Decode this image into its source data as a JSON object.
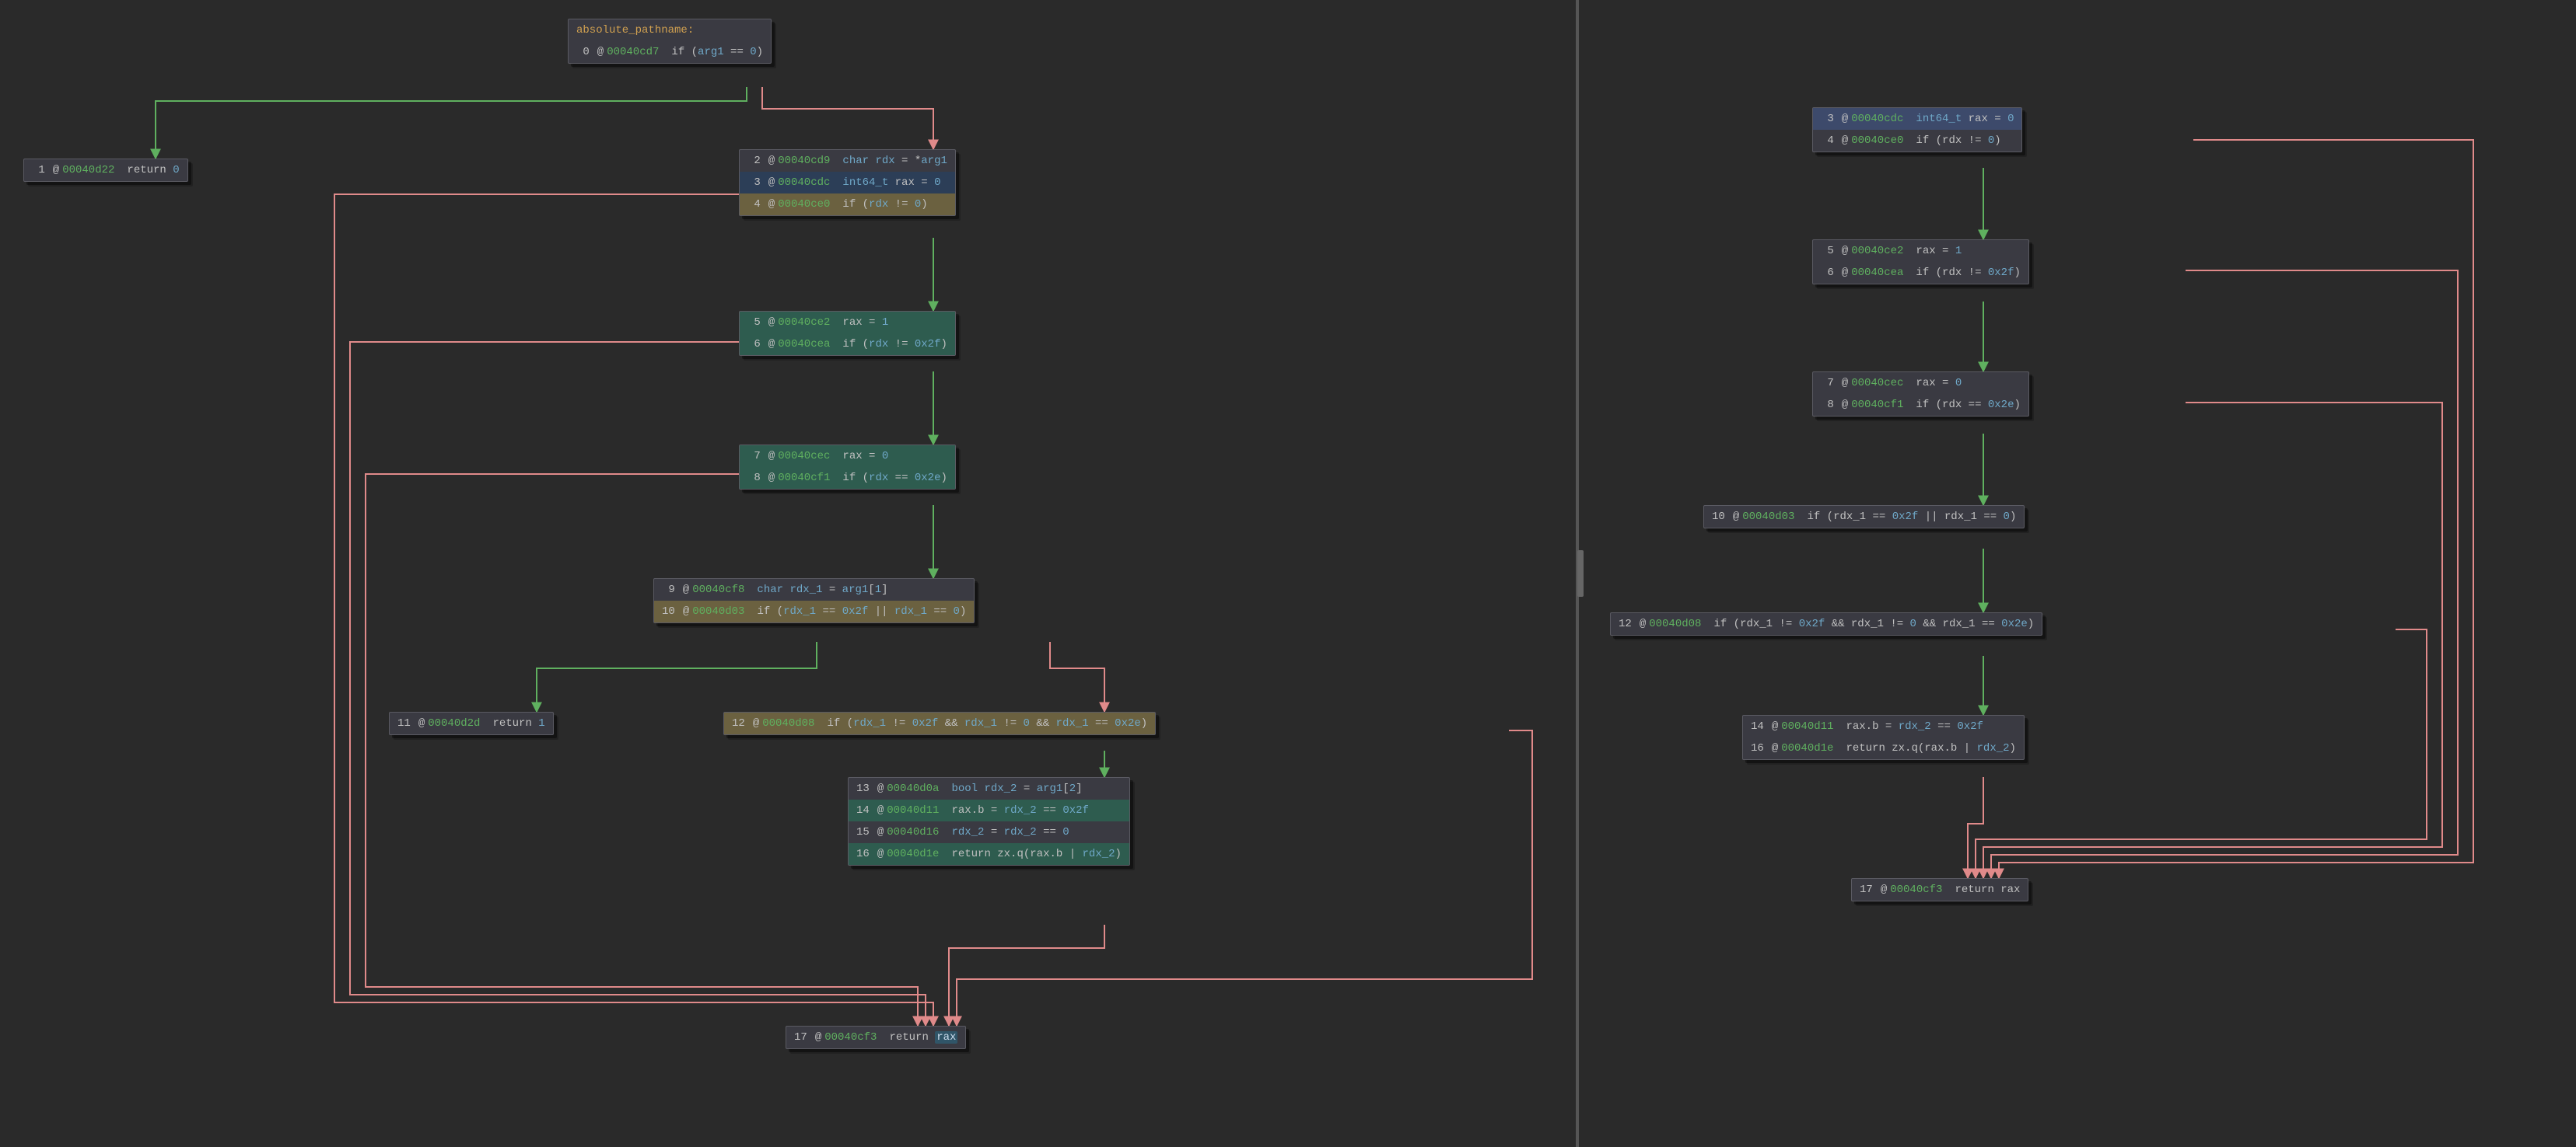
{
  "function_name": "absolute_pathname",
  "left": {
    "blocks": {
      "b0": {
        "title": "absolute_pathname:",
        "lines": [
          {
            "hl": "",
            "idx": "0",
            "addr": "00040cd7",
            "tokens": [
              [
                "kw",
                "if"
              ],
              [
                "op",
                " ("
              ],
              [
                "var",
                "arg1"
              ],
              [
                "op",
                " == "
              ],
              [
                "num",
                "0"
              ],
              [
                "op",
                ")"
              ]
            ]
          }
        ]
      },
      "b1": {
        "lines": [
          {
            "hl": "",
            "idx": "1",
            "addr": "00040d22",
            "tokens": [
              [
                "kw",
                "return "
              ],
              [
                "num",
                "0"
              ]
            ]
          }
        ]
      },
      "b2": {
        "lines": [
          {
            "hl": "",
            "idx": "2",
            "addr": "00040cd9",
            "tokens": [
              [
                "ty",
                "char "
              ],
              [
                "var",
                "rdx"
              ],
              [
                "op",
                " = *"
              ],
              [
                "var",
                "arg1"
              ]
            ]
          },
          {
            "hl": "hl-blue",
            "idx": "3",
            "addr": "00040cdc",
            "tokens": [
              [
                "ty",
                "int64_t "
              ],
              [
                "nm",
                "rax"
              ],
              [
                "op",
                " = "
              ],
              [
                "num",
                "0"
              ]
            ]
          },
          {
            "hl": "hl-olive",
            "idx": "4",
            "addr": "00040ce0",
            "tokens": [
              [
                "kw",
                "if"
              ],
              [
                "op",
                " ("
              ],
              [
                "var",
                "rdx"
              ],
              [
                "op",
                " != "
              ],
              [
                "num",
                "0"
              ],
              [
                "op",
                ")"
              ]
            ]
          }
        ]
      },
      "b5": {
        "lines": [
          {
            "hl": "hl-teal",
            "idx": "5",
            "addr": "00040ce2",
            "tokens": [
              [
                "nm",
                "rax"
              ],
              [
                "op",
                " = "
              ],
              [
                "num",
                "1"
              ]
            ]
          },
          {
            "hl": "hl-teal",
            "idx": "6",
            "addr": "00040cea",
            "tokens": [
              [
                "kw",
                "if"
              ],
              [
                "op",
                " ("
              ],
              [
                "var",
                "rdx"
              ],
              [
                "op",
                " != "
              ],
              [
                "num",
                "0x2f"
              ],
              [
                "op",
                ")"
              ]
            ]
          }
        ]
      },
      "b7": {
        "lines": [
          {
            "hl": "hl-teal",
            "idx": "7",
            "addr": "00040cec",
            "tokens": [
              [
                "nm",
                "rax"
              ],
              [
                "op",
                " = "
              ],
              [
                "num",
                "0"
              ]
            ]
          },
          {
            "hl": "hl-teal",
            "idx": "8",
            "addr": "00040cf1",
            "tokens": [
              [
                "kw",
                "if"
              ],
              [
                "op",
                " ("
              ],
              [
                "var",
                "rdx"
              ],
              [
                "op",
                " == "
              ],
              [
                "num",
                "0x2e"
              ],
              [
                "op",
                ")"
              ]
            ]
          }
        ]
      },
      "b9": {
        "lines": [
          {
            "hl": "",
            "idx": "9",
            "addr": "00040cf8",
            "tokens": [
              [
                "ty",
                "char "
              ],
              [
                "var",
                "rdx_1"
              ],
              [
                "op",
                " = "
              ],
              [
                "var",
                "arg1"
              ],
              [
                "op",
                "["
              ],
              [
                "num",
                "1"
              ],
              [
                "op",
                "]"
              ]
            ]
          },
          {
            "hl": "hl-olive",
            "idx": "10",
            "addr": "00040d03",
            "tokens": [
              [
                "kw",
                "if"
              ],
              [
                "op",
                " ("
              ],
              [
                "var",
                "rdx_1"
              ],
              [
                "op",
                " == "
              ],
              [
                "num",
                "0x2f"
              ],
              [
                "op",
                " || "
              ],
              [
                "var",
                "rdx_1"
              ],
              [
                "op",
                " == "
              ],
              [
                "num",
                "0"
              ],
              [
                "op",
                ")"
              ]
            ]
          }
        ]
      },
      "b11": {
        "lines": [
          {
            "hl": "",
            "idx": "11",
            "addr": "00040d2d",
            "tokens": [
              [
                "kw",
                "return "
              ],
              [
                "num",
                "1"
              ]
            ]
          }
        ]
      },
      "b12": {
        "lines": [
          {
            "hl": "hl-olive",
            "idx": "12",
            "addr": "00040d08",
            "tokens": [
              [
                "kw",
                "if"
              ],
              [
                "op",
                " ("
              ],
              [
                "var",
                "rdx_1"
              ],
              [
                "op",
                " != "
              ],
              [
                "num",
                "0x2f"
              ],
              [
                "op",
                " && "
              ],
              [
                "var",
                "rdx_1"
              ],
              [
                "op",
                " != "
              ],
              [
                "num",
                "0"
              ],
              [
                "op",
                " && "
              ],
              [
                "var",
                "rdx_1"
              ],
              [
                "op",
                " == "
              ],
              [
                "num",
                "0x2e"
              ],
              [
                "op",
                ")"
              ]
            ]
          }
        ]
      },
      "b13": {
        "lines": [
          {
            "hl": "",
            "idx": "13",
            "addr": "00040d0a",
            "tokens": [
              [
                "ty",
                "bool "
              ],
              [
                "var",
                "rdx_2"
              ],
              [
                "op",
                " = "
              ],
              [
                "var",
                "arg1"
              ],
              [
                "op",
                "["
              ],
              [
                "num",
                "2"
              ],
              [
                "op",
                "]"
              ]
            ]
          },
          {
            "hl": "hl-teal",
            "idx": "14",
            "addr": "00040d11",
            "tokens": [
              [
                "nm",
                "rax"
              ],
              [
                "op",
                "."
              ],
              [
                "nm",
                "b"
              ],
              [
                "op",
                " = "
              ],
              [
                "var",
                "rdx_2"
              ],
              [
                "op",
                " == "
              ],
              [
                "num",
                "0x2f"
              ]
            ]
          },
          {
            "hl": "",
            "idx": "15",
            "addr": "00040d16",
            "tokens": [
              [
                "var",
                "rdx_2"
              ],
              [
                "op",
                " = "
              ],
              [
                "var",
                "rdx_2"
              ],
              [
                "op",
                " == "
              ],
              [
                "num",
                "0"
              ]
            ]
          },
          {
            "hl": "hl-teal",
            "idx": "16",
            "addr": "00040d1e",
            "tokens": [
              [
                "kw",
                "return "
              ],
              [
                "nm",
                "zx.q"
              ],
              [
                "op",
                "("
              ],
              [
                "nm",
                "rax"
              ],
              [
                "op",
                "."
              ],
              [
                "nm",
                "b"
              ],
              [
                "op",
                " | "
              ],
              [
                "var",
                "rdx_2"
              ],
              [
                "op",
                ")"
              ]
            ]
          }
        ]
      },
      "b17": {
        "lines": [
          {
            "hl": "",
            "idx": "17",
            "addr": "00040cf3",
            "tokens": [
              [
                "kw",
                "return "
              ],
              [
                "hl-reg",
                "rax"
              ]
            ]
          }
        ]
      }
    }
  },
  "right": {
    "blocks": {
      "r3": {
        "lines": [
          {
            "hl": "hl-sel",
            "idx": "3",
            "addr": "00040cdc",
            "tokens": [
              [
                "ty",
                "int64_t "
              ],
              [
                "nm",
                "rax"
              ],
              [
                "op",
                " = "
              ],
              [
                "num",
                "0"
              ]
            ]
          },
          {
            "hl": "",
            "idx": "4",
            "addr": "00040ce0",
            "tokens": [
              [
                "kw",
                "if"
              ],
              [
                "op",
                " ("
              ],
              [
                "nm",
                "rdx"
              ],
              [
                "op",
                " != "
              ],
              [
                "num",
                "0"
              ],
              [
                "op",
                ")"
              ]
            ]
          }
        ]
      },
      "r5": {
        "lines": [
          {
            "hl": "",
            "idx": "5",
            "addr": "00040ce2",
            "tokens": [
              [
                "nm",
                "rax"
              ],
              [
                "op",
                " = "
              ],
              [
                "num",
                "1"
              ]
            ]
          },
          {
            "hl": "",
            "idx": "6",
            "addr": "00040cea",
            "tokens": [
              [
                "kw",
                "if"
              ],
              [
                "op",
                " ("
              ],
              [
                "nm",
                "rdx"
              ],
              [
                "op",
                " != "
              ],
              [
                "num",
                "0x2f"
              ],
              [
                "op",
                ")"
              ]
            ]
          }
        ]
      },
      "r7": {
        "lines": [
          {
            "hl": "",
            "idx": "7",
            "addr": "00040cec",
            "tokens": [
              [
                "nm",
                "rax"
              ],
              [
                "op",
                " = "
              ],
              [
                "num",
                "0"
              ]
            ]
          },
          {
            "hl": "",
            "idx": "8",
            "addr": "00040cf1",
            "tokens": [
              [
                "kw",
                "if"
              ],
              [
                "op",
                " ("
              ],
              [
                "nm",
                "rdx"
              ],
              [
                "op",
                " == "
              ],
              [
                "num",
                "0x2e"
              ],
              [
                "op",
                ")"
              ]
            ]
          }
        ]
      },
      "r10": {
        "lines": [
          {
            "hl": "",
            "idx": "10",
            "addr": "00040d03",
            "tokens": [
              [
                "kw",
                "if"
              ],
              [
                "op",
                " ("
              ],
              [
                "nm",
                "rdx_1"
              ],
              [
                "op",
                " == "
              ],
              [
                "num",
                "0x2f"
              ],
              [
                "op",
                " || "
              ],
              [
                "nm",
                "rdx_1"
              ],
              [
                "op",
                " == "
              ],
              [
                "num",
                "0"
              ],
              [
                "op",
                ")"
              ]
            ]
          }
        ]
      },
      "r12": {
        "lines": [
          {
            "hl": "",
            "idx": "12",
            "addr": "00040d08",
            "tokens": [
              [
                "kw",
                "if"
              ],
              [
                "op",
                " ("
              ],
              [
                "nm",
                "rdx_1"
              ],
              [
                "op",
                " != "
              ],
              [
                "num",
                "0x2f"
              ],
              [
                "op",
                " && "
              ],
              [
                "nm",
                "rdx_1"
              ],
              [
                "op",
                " != "
              ],
              [
                "num",
                "0"
              ],
              [
                "op",
                " && "
              ],
              [
                "nm",
                "rdx_1"
              ],
              [
                "op",
                " == "
              ],
              [
                "num",
                "0x2e"
              ],
              [
                "op",
                ")"
              ]
            ]
          }
        ]
      },
      "r14": {
        "lines": [
          {
            "hl": "",
            "idx": "14",
            "addr": "00040d11",
            "tokens": [
              [
                "nm",
                "rax"
              ],
              [
                "op",
                "."
              ],
              [
                "nm",
                "b"
              ],
              [
                "op",
                " = "
              ],
              [
                "var",
                "rdx_2"
              ],
              [
                "op",
                " == "
              ],
              [
                "num",
                "0x2f"
              ]
            ]
          },
          {
            "hl": "",
            "idx": "16",
            "addr": "00040d1e",
            "tokens": [
              [
                "kw",
                "return "
              ],
              [
                "nm",
                "zx.q"
              ],
              [
                "op",
                "("
              ],
              [
                "nm",
                "rax"
              ],
              [
                "op",
                "."
              ],
              [
                "nm",
                "b"
              ],
              [
                "op",
                " | "
              ],
              [
                "var",
                "rdx_2"
              ],
              [
                "op",
                ")"
              ]
            ]
          }
        ]
      },
      "r17": {
        "lines": [
          {
            "hl": "",
            "idx": "17",
            "addr": "00040cf3",
            "tokens": [
              [
                "kw",
                "return "
              ],
              [
                "nm",
                "rax"
              ]
            ]
          }
        ]
      }
    }
  },
  "colors": {
    "green": "#5fb05f",
    "red": "#e08a8a"
  }
}
